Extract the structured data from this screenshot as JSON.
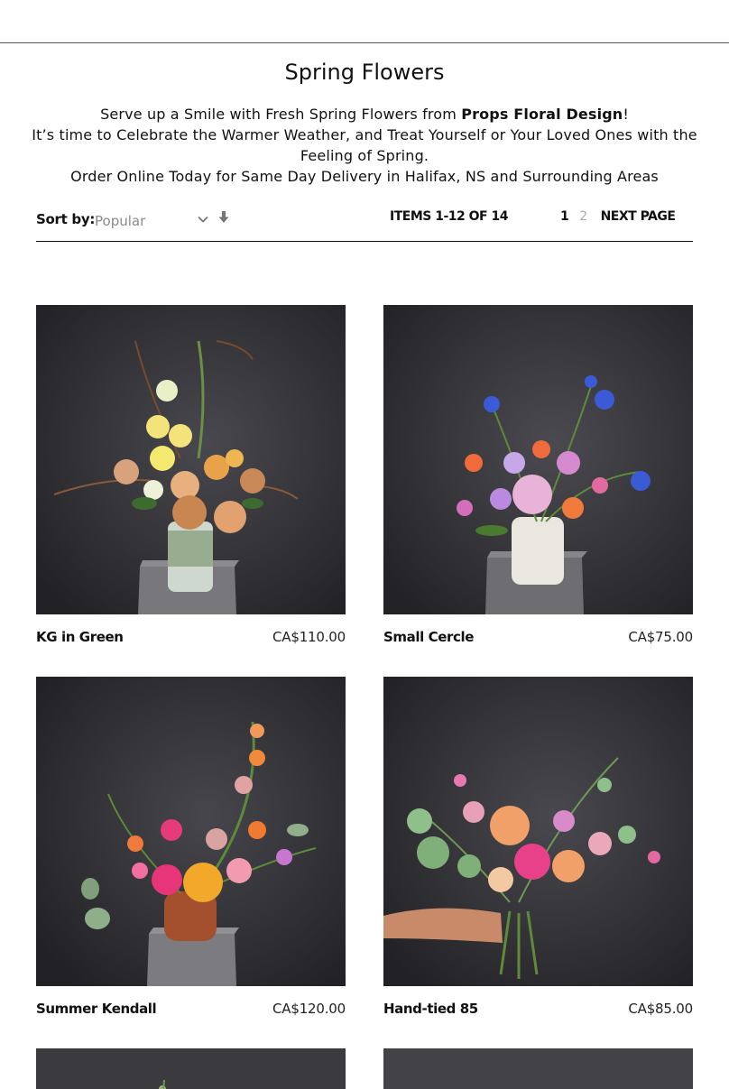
{
  "page": {
    "title": "Spring Flowers",
    "intro": {
      "line1_pre": "Serve up a Smile with Fresh Spring Flowers from ",
      "line1_brand": "Props Floral Design",
      "line1_post": "!",
      "line2": "It’s time to Celebrate the Warmer Weather, and Treat Yourself or Your Loved Ones with the Feeling of Spring.",
      "line3": "Order Online Today for Same Day Delivery in Halifax, NS and Surrounding Areas"
    }
  },
  "toolbar": {
    "sort_label": "Sort by:",
    "sort_value": "Popular",
    "sort_direction_icon": "arrow-down-icon",
    "items_count": "ITEMS 1-12 OF 14",
    "pager": {
      "current": "1",
      "other": "2",
      "next": "NEXT PAGE"
    }
  },
  "products": [
    {
      "name": "KG in Green",
      "price": "CA$110.00"
    },
    {
      "name": "Small Cercle",
      "price": "CA$75.00"
    },
    {
      "name": "Summer Kendall",
      "price": "CA$120.00"
    },
    {
      "name": "Hand-tied 85",
      "price": "CA$85.00"
    }
  ],
  "colors": {
    "photo_background": "#2f2f34",
    "text": "#111111",
    "muted": "#8a8a8a"
  }
}
